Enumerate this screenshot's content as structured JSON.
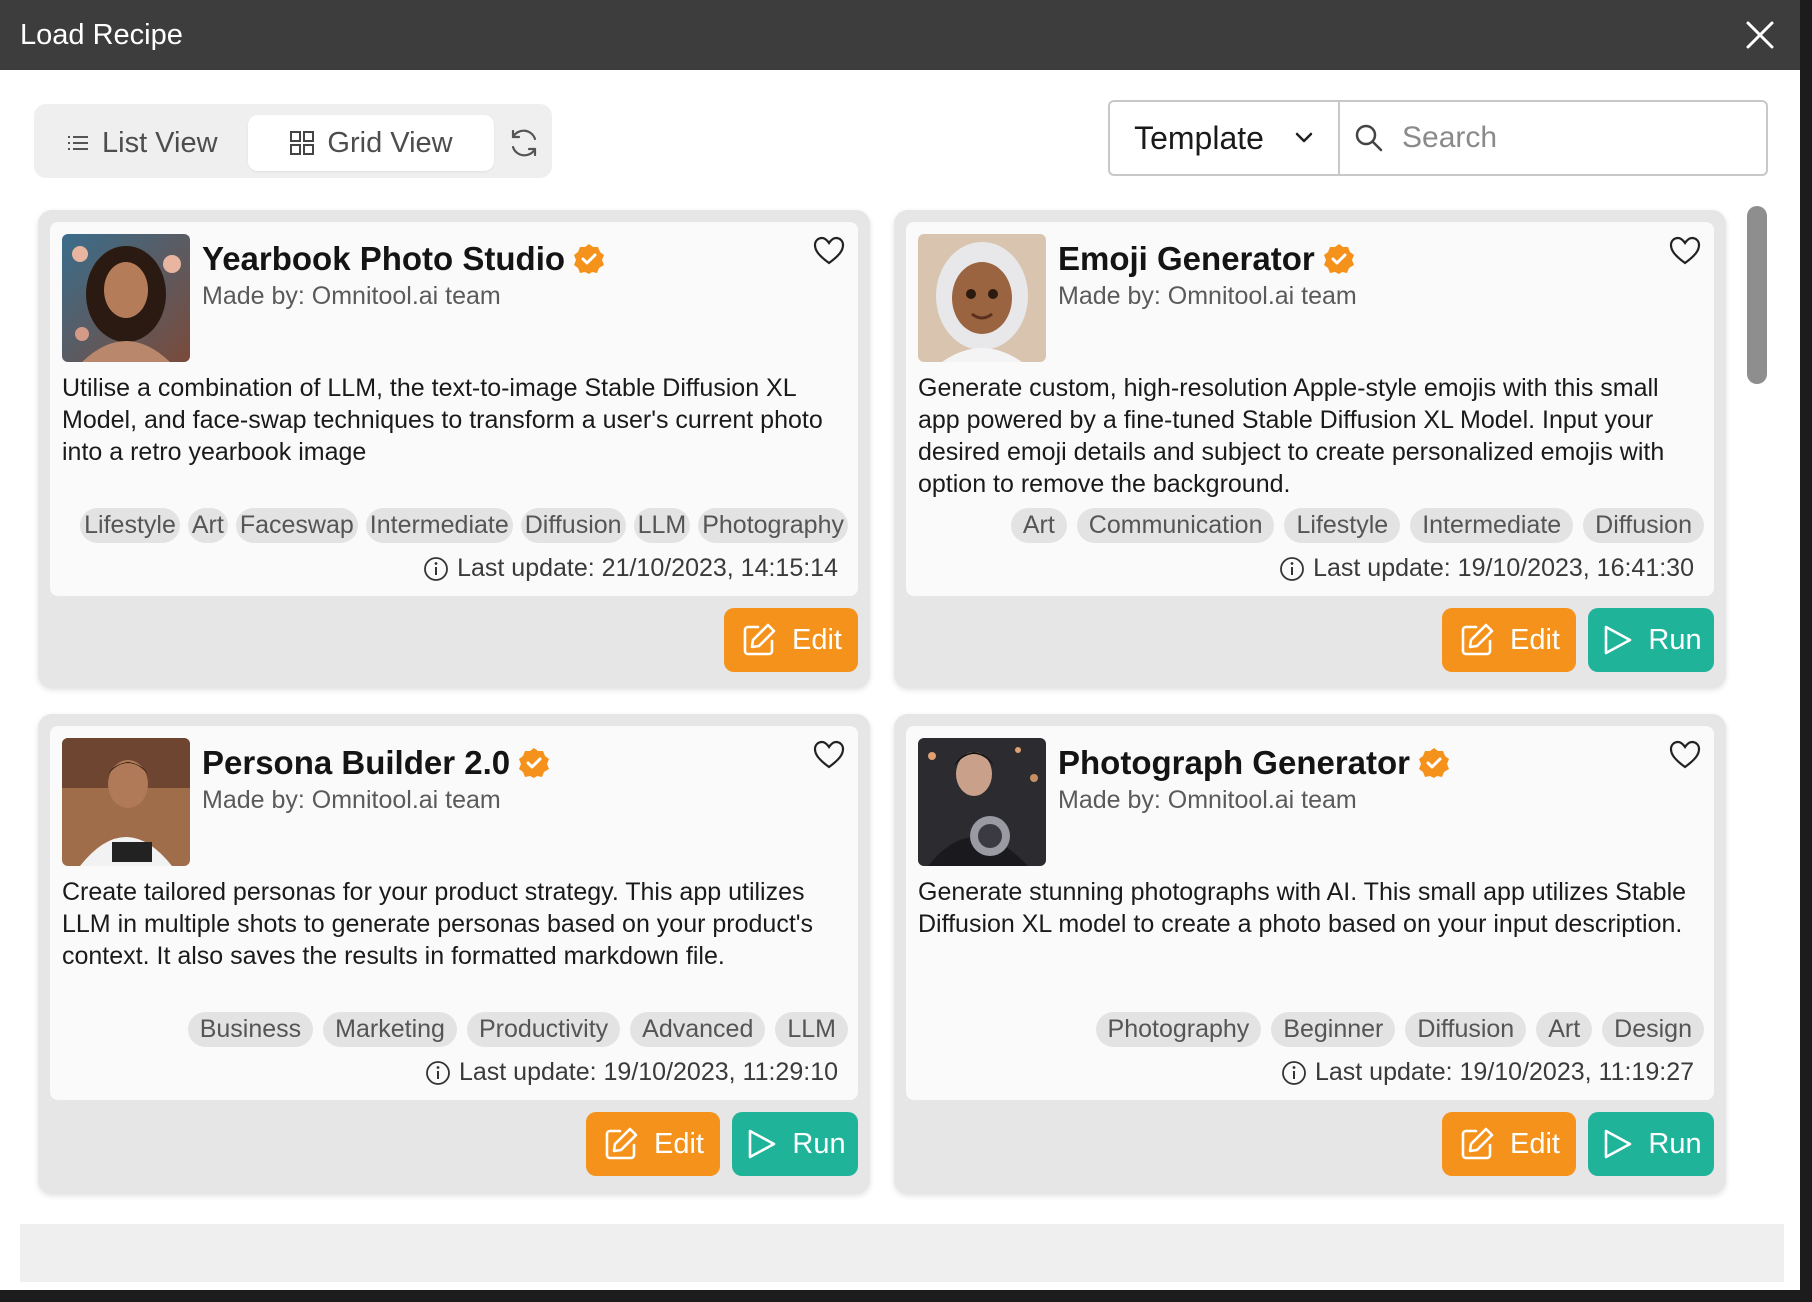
{
  "dialog": {
    "title": "Load Recipe"
  },
  "toolbar": {
    "list_view_label": "List View",
    "grid_view_label": "Grid View",
    "filter_selected": "Template",
    "search_placeholder": "Search"
  },
  "cards": [
    {
      "title": "Yearbook Photo Studio",
      "author": "Made by: Omnitool.ai team",
      "description": "Utilise a combination of LLM, the text-to-image Stable Diffusion XL Model, and face-swap techniques to transform a user's current photo into a retro yearbook image",
      "tags": [
        "Lifestyle",
        "Art",
        "Faceswap",
        "Intermediate",
        "Diffusion",
        "LLM",
        "Photography"
      ],
      "updated": "Last update: 21/10/2023, 14:15:14",
      "edit_label": "Edit"
    },
    {
      "title": "Emoji Generator",
      "author": "Made by: Omnitool.ai team",
      "description": "Generate custom, high-resolution Apple-style emojis with this small app powered by a fine-tuned Stable Diffusion XL Model. Input your desired emoji details and subject to create personalized emojis with option to remove the background.",
      "tags": [
        "Art",
        "Communication",
        "Lifestyle",
        "Intermediate",
        "Diffusion"
      ],
      "updated": "Last update: 19/10/2023, 16:41:30",
      "edit_label": "Edit",
      "run_label": "Run"
    },
    {
      "title": "Persona Builder 2.0",
      "author": "Made by: Omnitool.ai team",
      "description": "Create tailored personas for your product strategy. This app utilizes LLM in multiple shots to generate personas based on your product's context. It also saves the results in formatted markdown file.",
      "tags": [
        "Business",
        "Marketing",
        "Productivity",
        "Advanced",
        "LLM"
      ],
      "updated": "Last update: 19/10/2023, 11:29:10",
      "edit_label": "Edit",
      "run_label": "Run"
    },
    {
      "title": "Photograph Generator",
      "author": "Made by: Omnitool.ai team",
      "description": "Generate stunning photographs with AI. This small app utilizes Stable Diffusion XL model to create a photo based on your input description.",
      "tags": [
        "Photography",
        "Beginner",
        "Diffusion",
        "Art",
        "Design"
      ],
      "updated": "Last update: 19/10/2023, 11:19:27",
      "edit_label": "Edit",
      "run_label": "Run"
    }
  ],
  "colors": {
    "edit": "#f5921b",
    "run": "#1fb39a",
    "verified": "#f5921b"
  }
}
